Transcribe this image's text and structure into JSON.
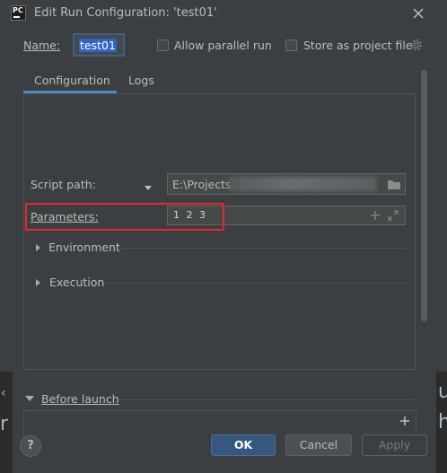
{
  "window": {
    "title": "Edit Run Configuration: 'test01'",
    "app_icon_text": "PC"
  },
  "name_field": {
    "label": "Name:",
    "value": "test01"
  },
  "options": {
    "allow_parallel_label": "Allow parallel run",
    "allow_parallel_checked": false,
    "store_project_label": "Store as project file",
    "store_project_checked": false
  },
  "tabs": [
    {
      "label": "Configuration",
      "active": true
    },
    {
      "label": "Logs",
      "active": false
    }
  ],
  "form": {
    "script_path_label": "Script path:",
    "script_path_value": "E:\\Projects",
    "parameters_label": "Parameters:",
    "parameters_value": "1 2 3",
    "environment_label": "Environment",
    "execution_label": "Execution"
  },
  "before_launch": {
    "label": "Before launch"
  },
  "buttons": {
    "help": "?",
    "ok": "OK",
    "cancel": "Cancel",
    "apply": "Apply"
  },
  "background_glimpse": {
    "right_top": "u",
    "right_bottom": "h",
    "left_bottom": "r",
    "left_top": "‹"
  },
  "colors": {
    "dialog_bg": "#3c3f41",
    "accent": "#4a88c7",
    "selection": "#2f65ca",
    "highlight_box": "#e8262f",
    "ok_button": "#365880"
  },
  "icons": {
    "close": "close-icon",
    "settings": "gear-icon",
    "browse": "folder-icon",
    "add": "plus-icon",
    "expand": "expand-icon"
  }
}
